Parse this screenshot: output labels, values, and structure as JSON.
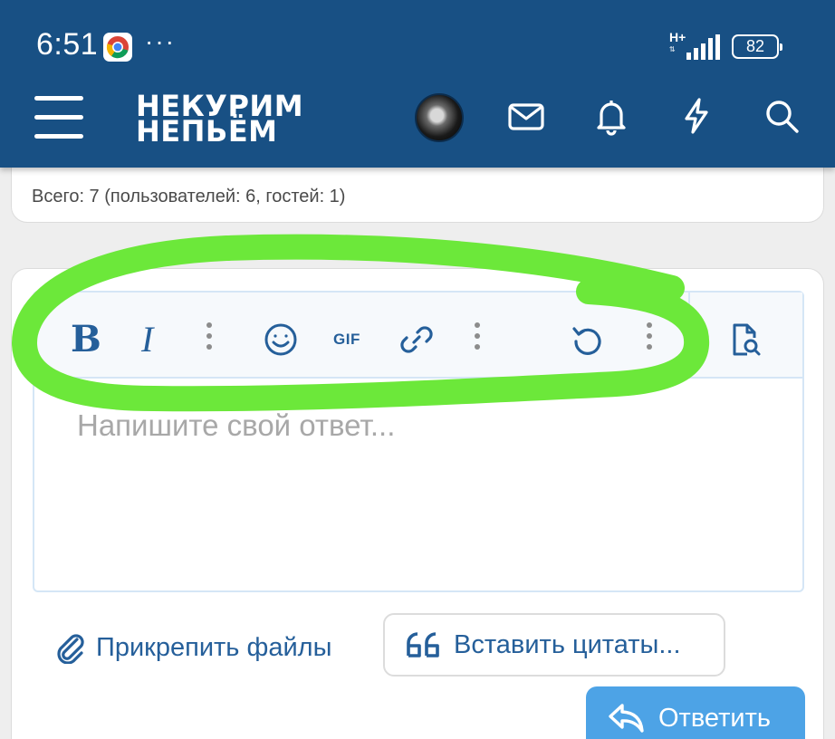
{
  "status_bar": {
    "time": "6:51",
    "dots": "···",
    "network": "H+",
    "battery": "82"
  },
  "header": {
    "logo_line1": "НЕКУРИМ",
    "logo_line2": "НЕПЬЁМ",
    "brand_color": "#185084"
  },
  "online": {
    "text": "Всего: 7 (пользователей: 6, гостей: 1)"
  },
  "editor": {
    "toolbar": {
      "gif_label": "GIF"
    },
    "placeholder": "Напишите свой ответ..."
  },
  "actions": {
    "attach_label": "Прикрепить файлы",
    "insert_quotes_label": "Вставить цитаты...",
    "reply_label": "Ответить"
  },
  "annotation_color": "#6ce83a"
}
